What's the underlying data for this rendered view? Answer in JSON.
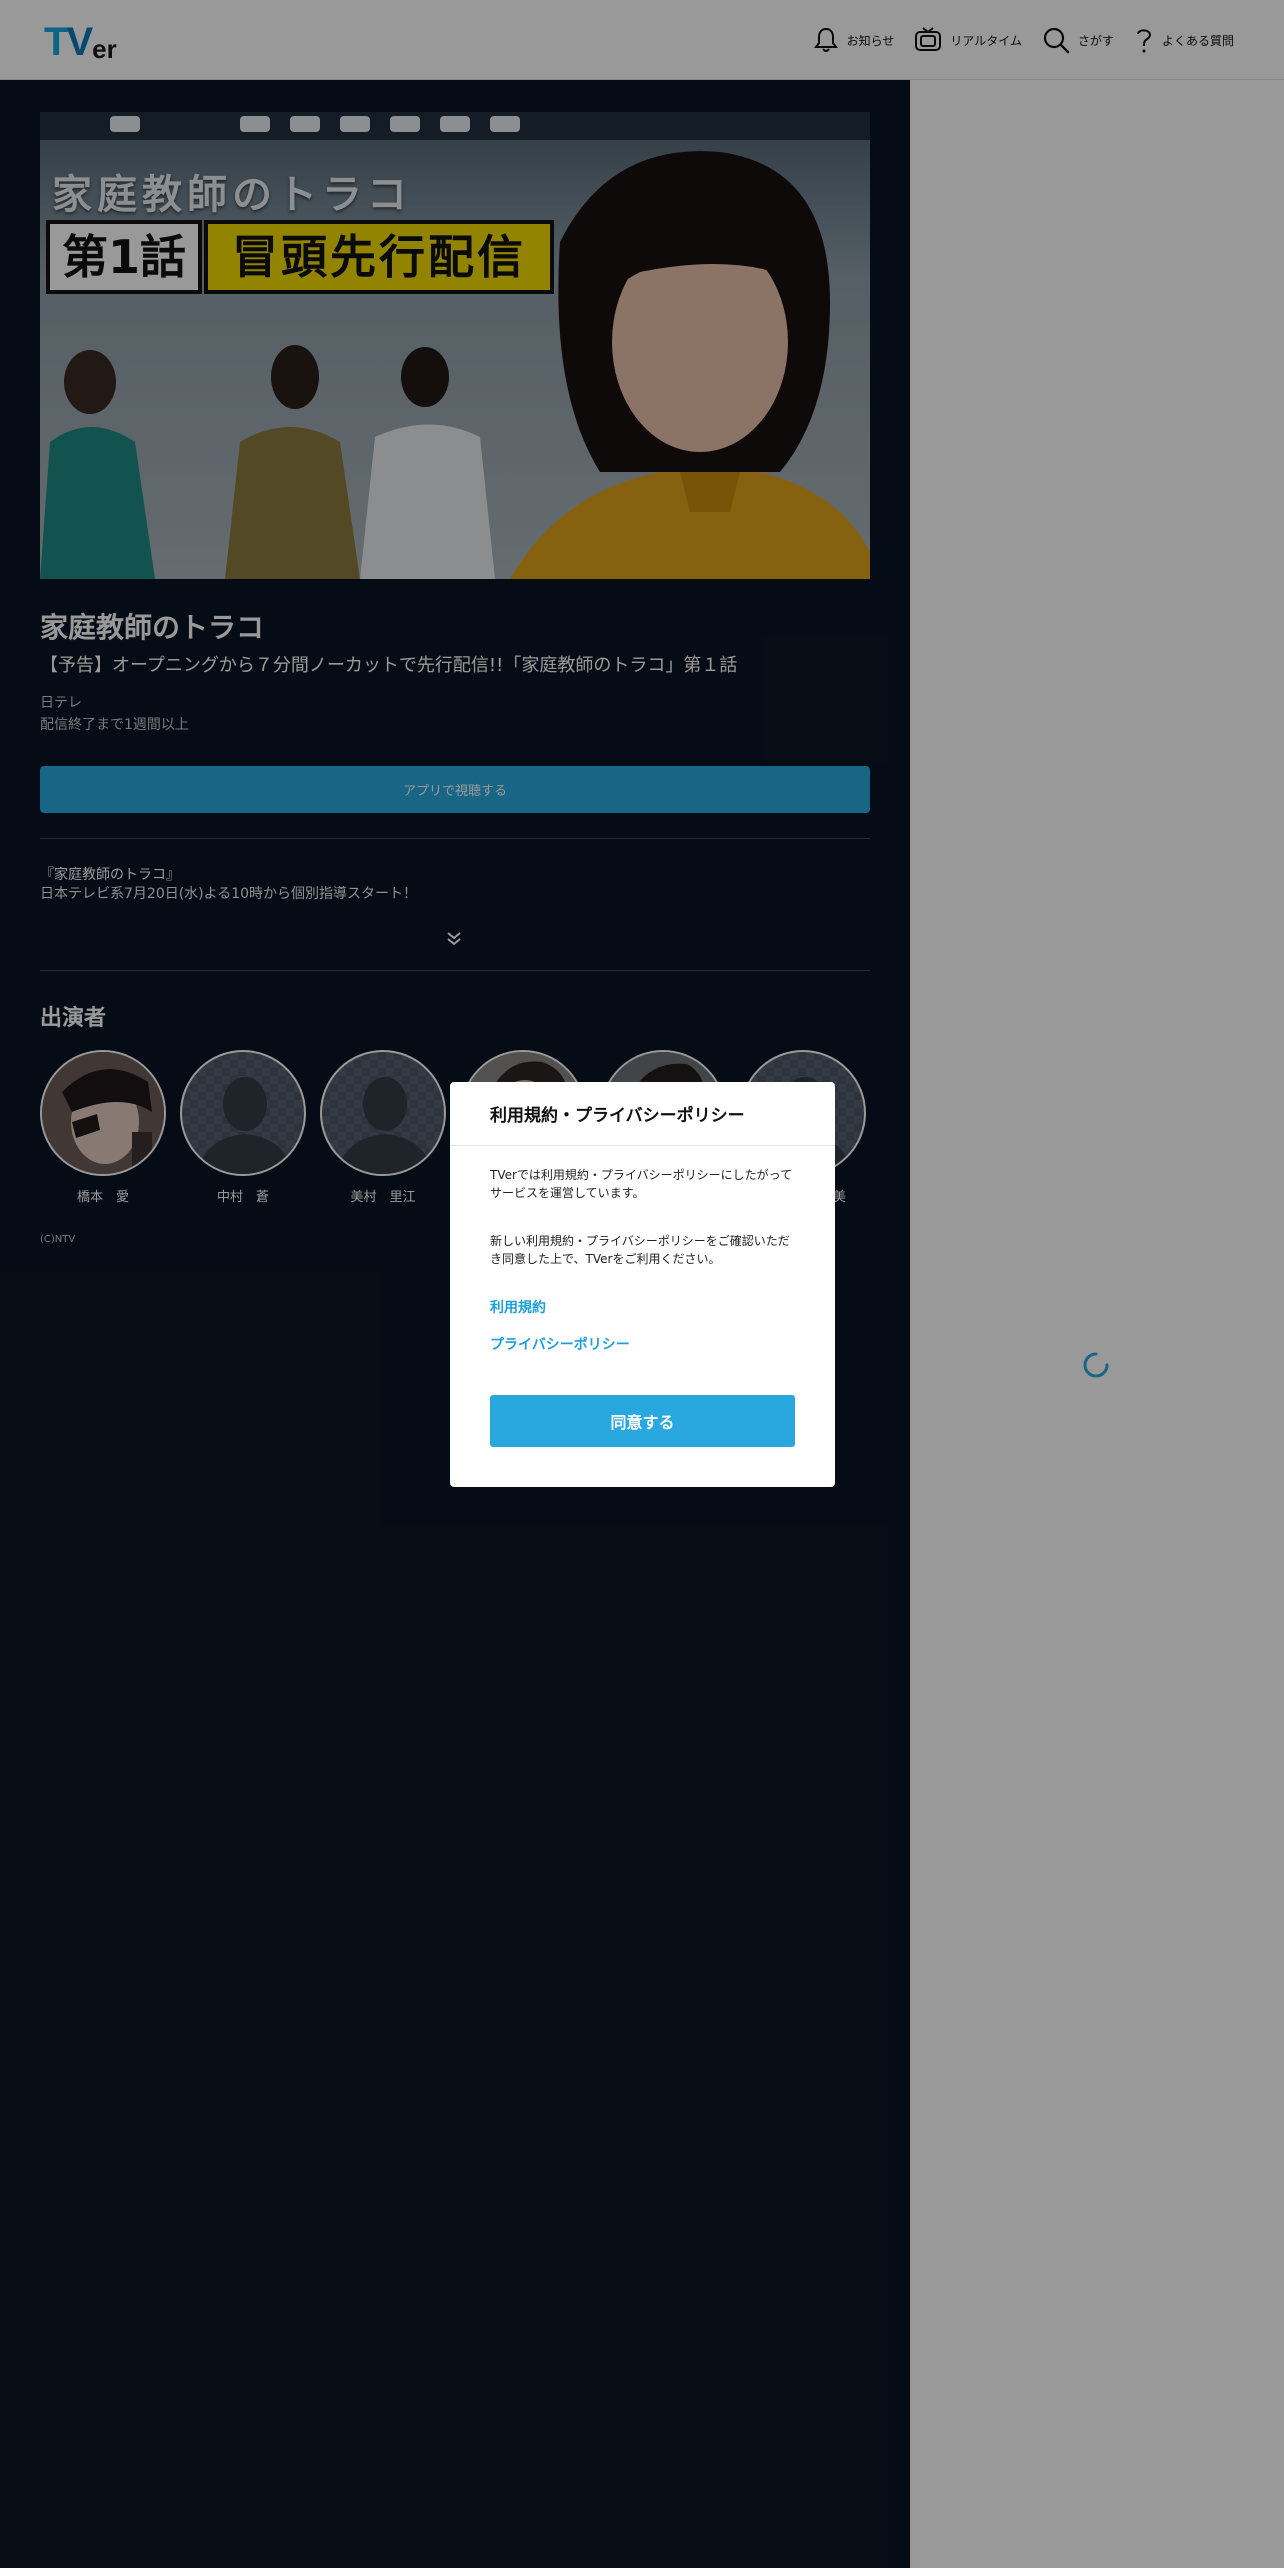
{
  "header": {
    "logo": {
      "t": "T",
      "v": "V",
      "er": "er"
    },
    "nav": [
      {
        "icon": "bell-icon",
        "label": "お知らせ"
      },
      {
        "icon": "tv-icon",
        "label": "リアルタイム"
      },
      {
        "icon": "search-icon",
        "label": "さがす"
      },
      {
        "icon": "question-icon",
        "label": "よくある質問"
      }
    ]
  },
  "hero": {
    "line1": "家庭教師のトラコ",
    "box1": "第1話",
    "box2": "冒頭先行配信"
  },
  "episode": {
    "title": "家庭教師のトラコ",
    "subtitle": "【予告】オープニングから７分間ノーカットで先行配信!!「家庭教師のトラコ」第１話",
    "broadcaster": "日テレ",
    "availability": "配信終了まで1週間以上",
    "watch_button": "アプリで視聴する",
    "description_line1": "『家庭教師のトラコ』",
    "description_line2": "日本テレビ系7月20日(水)よる10時から個別指導スタート！"
  },
  "cast": {
    "heading": "出演者",
    "members": [
      {
        "name": "橋本　愛",
        "photo": true
      },
      {
        "name": "中村　蒼",
        "photo": false
      },
      {
        "name": "美村　里江",
        "photo": false
      },
      {
        "name": "",
        "photo": true
      },
      {
        "name": "",
        "photo": true
      },
      {
        "name": "",
        "photo": false
      }
    ],
    "last_name_fragment": "美"
  },
  "copyright": "(C)NTV",
  "modal": {
    "title": "利用規約・プライバシーポリシー",
    "paragraph1": "TVerでは利用規約・プライバシーポリシーにしたがってサービスを運営しています。",
    "paragraph2": "新しい利用規約・プライバシーポリシーをご確認いただき同意した上で、TVerをご利用ください。",
    "link_terms": "利用規約",
    "link_privacy": "プライバシーポリシー",
    "agree_button": "同意する"
  },
  "colors": {
    "accent": "#29a8e0",
    "page_dark": "#0a1523",
    "overlay": "rgba(0,0,0,0.4)"
  }
}
